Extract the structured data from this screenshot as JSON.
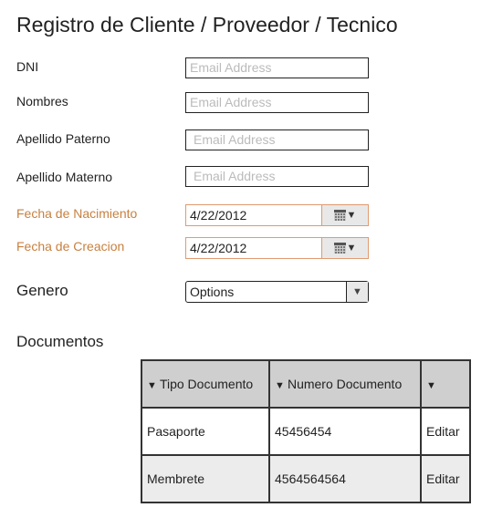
{
  "title": "Registro de Cliente / Proveedor / Tecnico",
  "fields": [
    {
      "label": "DNI",
      "placeholder": "Email Address"
    },
    {
      "label": "Nombres",
      "placeholder": "Email Address"
    },
    {
      "label": "Apellido Paterno",
      "placeholder": "Email Address"
    },
    {
      "label": "Apellido Materno",
      "placeholder": "Email Address"
    }
  ],
  "dates": [
    {
      "label": "Fecha de Nacimiento",
      "value": "4/22/2012"
    },
    {
      "label": "Fecha de Creacion",
      "value": "4/22/2012"
    }
  ],
  "label_color": "#c8803f",
  "genero": {
    "label": "Genero",
    "value": "Options"
  },
  "documentos": {
    "label": "Documentos",
    "columns": [
      "Tipo Documento",
      "Numero Documento",
      ""
    ],
    "rows": [
      [
        "Pasaporte",
        "45456454",
        "Editar"
      ],
      [
        "Membrete",
        "4564564564",
        "Editar"
      ]
    ]
  }
}
